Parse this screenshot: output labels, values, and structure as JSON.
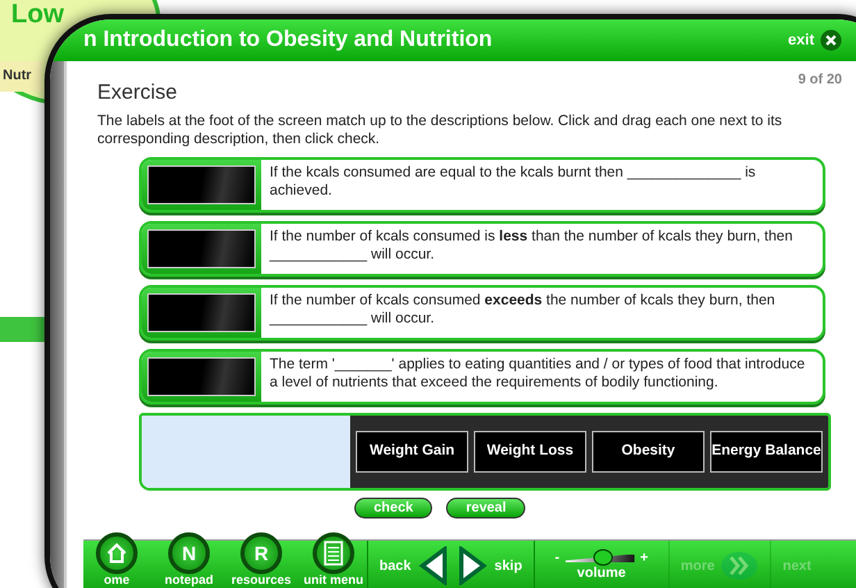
{
  "background_app": {
    "logo_text": "Low",
    "tab_label": "Nutr"
  },
  "window": {
    "title": "n Introduction to Obesity and Nutrition",
    "exit_label": "exit"
  },
  "exercise": {
    "heading": "Exercise",
    "page_counter": "9 of 20",
    "instructions": "The labels at the foot of the screen match up to the descriptions below. Click and drag each one next to its corresponding description, then click check.",
    "descriptions": [
      {
        "text": "If the kcals consumed are equal to the kcals burnt then ______________ is achieved."
      },
      {
        "text": "If the number of kcals consumed is **less** than the number of kcals they burn, then ____________ will occur."
      },
      {
        "text": "If the number of kcals consumed **exceeds** the number of kcals they burn, then ____________ will occur."
      },
      {
        "text": "The term '_______' applies to eating quantities and / or types of food that introduce a level of nutrients that exceed the requirements of bodily functioning."
      }
    ],
    "labels": [
      "Weight Gain",
      "Weight Loss",
      "Obesity",
      "Energy Balance"
    ],
    "buttons": [
      "check",
      "reveal"
    ]
  },
  "toolbar": {
    "nav_buttons": [
      {
        "label": "ome",
        "kind": "home"
      },
      {
        "glyph": "N",
        "label": "notepad",
        "kind": "letter"
      },
      {
        "glyph": "R",
        "label": "resources",
        "kind": "letter"
      },
      {
        "label": "unit menu",
        "kind": "menu"
      }
    ],
    "back_label": "back",
    "skip_label": "skip",
    "volume": {
      "minus": "-",
      "plus": "+",
      "label": "volume",
      "level": 0.55
    },
    "more": {
      "label": "more",
      "disabled": true
    },
    "next": {
      "label": "next",
      "disabled": true
    }
  }
}
